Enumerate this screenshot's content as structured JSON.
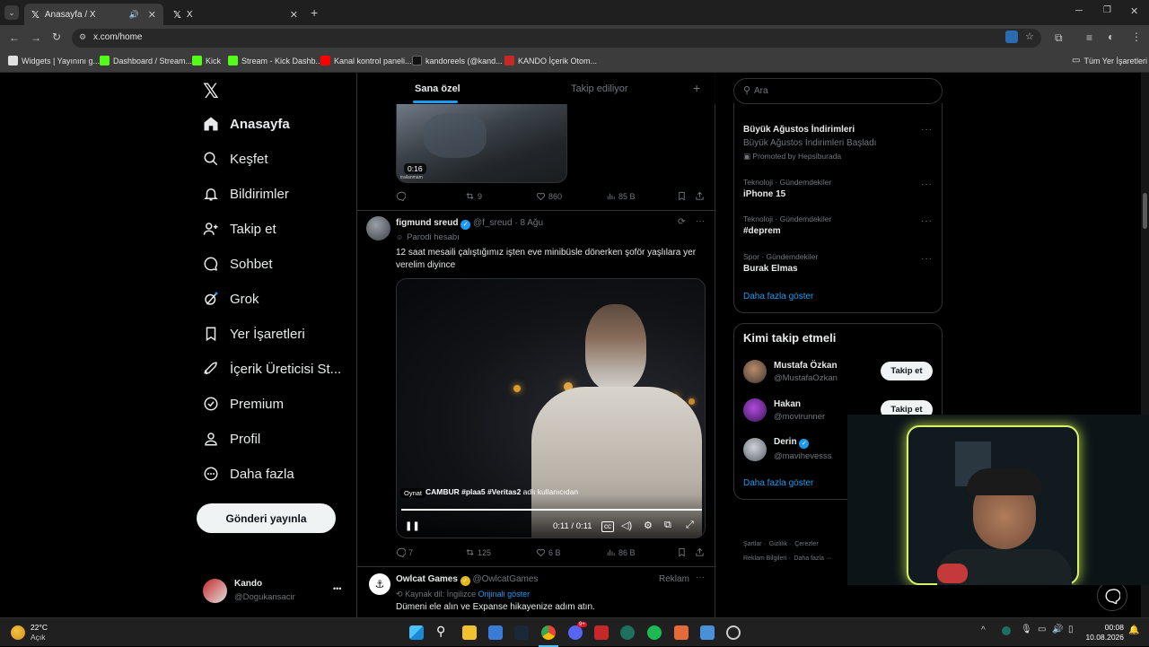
{
  "browser": {
    "tabs": [
      {
        "title": "Anasayfa / X",
        "active": true
      },
      {
        "title": "X",
        "active": false
      }
    ],
    "new_tab": "+",
    "url": "x.com/home",
    "bookmarks": [
      {
        "label": "Widgets | Yayınını g...",
        "color": "#e0e0e0"
      },
      {
        "label": "Dashboard / Stream...",
        "color": "#53fc18"
      },
      {
        "label": "Kick",
        "color": "#53fc18"
      },
      {
        "label": "Stream - Kick Dashb...",
        "color": "#53fc18"
      },
      {
        "label": "Kanal kontrol paneli...",
        "color": "#ff0000"
      },
      {
        "label": "kandoreels (@kand...",
        "color": "#111111"
      },
      {
        "label": "KANDO İçerik Otom...",
        "color": "#c62828"
      }
    ],
    "all_bookmarks": "Tüm Yer İşaretleri"
  },
  "sidebar": {
    "logo": "X",
    "items": [
      {
        "label": "Anasayfa",
        "icon": "home-icon",
        "bold": true
      },
      {
        "label": "Keşfet",
        "icon": "search-icon"
      },
      {
        "label": "Bildirimler",
        "icon": "bell-icon"
      },
      {
        "label": "Takip et",
        "icon": "person-add-icon"
      },
      {
        "label": "Sohbet",
        "icon": "chat-icon"
      },
      {
        "label": "Grok",
        "icon": "grok-icon"
      },
      {
        "label": "Yer İşaretleri",
        "icon": "bookmark-icon"
      },
      {
        "label": "İçerik Üreticisi St...",
        "icon": "rocket-icon"
      },
      {
        "label": "Premium",
        "icon": "premium-icon"
      },
      {
        "label": "Profil",
        "icon": "profile-icon"
      },
      {
        "label": "Daha fazla",
        "icon": "more-icon"
      }
    ],
    "post_button": "Gönderi yayınla",
    "account": {
      "name": "Kando",
      "handle": "@Dogukansacir",
      "more": "•••"
    }
  },
  "feed": {
    "tabs": [
      "Sana özel",
      "Takip ediliyor"
    ],
    "add": "+",
    "prev_post": {
      "video_time": "0:16",
      "watermark": "trailanmam",
      "actions": {
        "reply": "",
        "repost": "9",
        "like": "860",
        "views": "85 B"
      }
    },
    "post": {
      "name": "figmund sreud",
      "handle": "@f_sreud",
      "sep": "·",
      "date": "8 Ağu",
      "parody_label": "Parodi hesabı",
      "text": "12 saat mesaili çalıştığımız işten eve minibüsle dönerken şoför yaşlılara yer verelim diyince",
      "video_caption_tags": "CAMBUR #plaa5 #Veritas2",
      "video_caption_suffix": "adlı kullanıcıdan",
      "tooltip": "Oynat",
      "time": "0:11 / 0:11",
      "progress": 1.0,
      "actions": {
        "reply": "7",
        "repost": "125",
        "like": "6 B",
        "views": "86 B"
      }
    },
    "ad": {
      "name": "Owlcat Games",
      "handle": "@OwlcatGames",
      "label": "Reklam",
      "source_lang": "Kaynak dil: İngilizce",
      "show_original": "Orijinali göster",
      "text": "Dümeni ele alın ve Expanse hikayenize adım atın."
    }
  },
  "right": {
    "search_placeholder": "Ara",
    "trends": [
      {
        "category": "",
        "name": "Büyük Ağustos İndirimleri",
        "sub": "Büyük Ağustos İndirimleri Başladı",
        "promoted": "Promoted by Hepsiburada"
      },
      {
        "category": "Teknoloji · Gündemdekiler",
        "name": "iPhone 15"
      },
      {
        "category": "Teknoloji · Gündemdekiler",
        "name": "#deprem"
      },
      {
        "category": "Spor · Gündemdekiler",
        "name": "Burak Elmas"
      }
    ],
    "show_more": "Daha fazla göster",
    "who_to_follow": {
      "title": "Kimi takip etmeli",
      "users": [
        {
          "name": "Mustafa Özkan",
          "handle": "@MustafaOzkan",
          "verified": false,
          "button": "Takip et"
        },
        {
          "name": "Hakan",
          "handle": "@movirunner",
          "verified": false,
          "button": "Takip et"
        },
        {
          "name": "Derin",
          "handle": "@mavihevesss",
          "verified": true,
          "button": "Takip et"
        }
      ],
      "show_more": "Daha fazla göster"
    },
    "footer": [
      "Şartlar",
      "Gizlilik",
      "Çerezler",
      "Reklam Bilgileri",
      "Daha fazla ···"
    ]
  },
  "taskbar": {
    "weather_temp": "22°C",
    "weather_desc": "Açık",
    "time": "00:08",
    "date": "10.08.2026",
    "badge_discord": "9+"
  }
}
